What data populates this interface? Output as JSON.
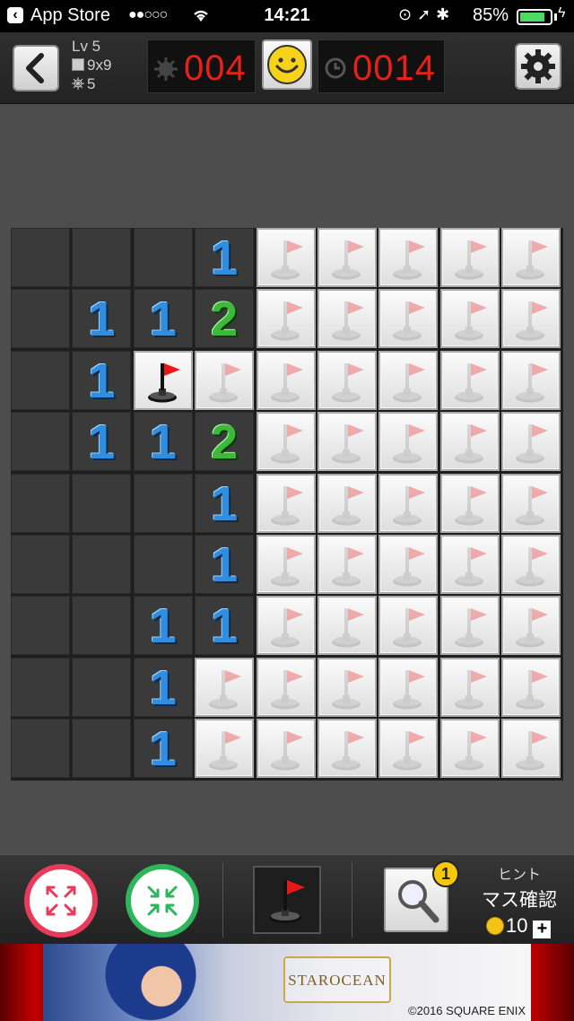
{
  "status_bar": {
    "carrier": "App Store",
    "signal": "●●○○○",
    "time": "14:21",
    "battery": "85%",
    "battery_level": 0.85
  },
  "header": {
    "level": "Lv 5",
    "size": "9x9",
    "mines": "5",
    "mine_counter": "004",
    "timer": "0014"
  },
  "board": {
    "rows": 9,
    "cols": 9,
    "cells": [
      [
        "",
        "",
        "",
        "1",
        "c",
        "c",
        "c",
        "c",
        "c"
      ],
      [
        "",
        "1",
        "1",
        "2",
        "c",
        "c",
        "c",
        "c",
        "c"
      ],
      [
        "",
        "1",
        "F",
        "c",
        "c",
        "c",
        "c",
        "c",
        "c"
      ],
      [
        "",
        "1",
        "1",
        "2",
        "c",
        "c",
        "c",
        "c",
        "c"
      ],
      [
        "",
        "",
        "",
        "1",
        "c",
        "c",
        "c",
        "c",
        "c"
      ],
      [
        "",
        "",
        "",
        "1",
        "c",
        "c",
        "c",
        "c",
        "c"
      ],
      [
        "",
        "",
        "1",
        "1",
        "c",
        "c",
        "c",
        "c",
        "c"
      ],
      [
        "",
        "",
        "1",
        "c",
        "c",
        "c",
        "c",
        "c",
        "c"
      ],
      [
        "",
        "",
        "1",
        "c",
        "c",
        "c",
        "c",
        "c",
        "c"
      ]
    ]
  },
  "toolbar": {
    "hint_badge": "1",
    "hint_label": "ヒント",
    "hint_title": "マス確認",
    "hint_cost": "10"
  },
  "ad": {
    "logo": "STAROCEAN",
    "copyright": "©2016 SQUARE ENIX"
  },
  "colors": {
    "num1": "#2f8ee0",
    "num2": "#3db83a",
    "counter_red": "#e8201a",
    "flag_red": "#e81818"
  }
}
